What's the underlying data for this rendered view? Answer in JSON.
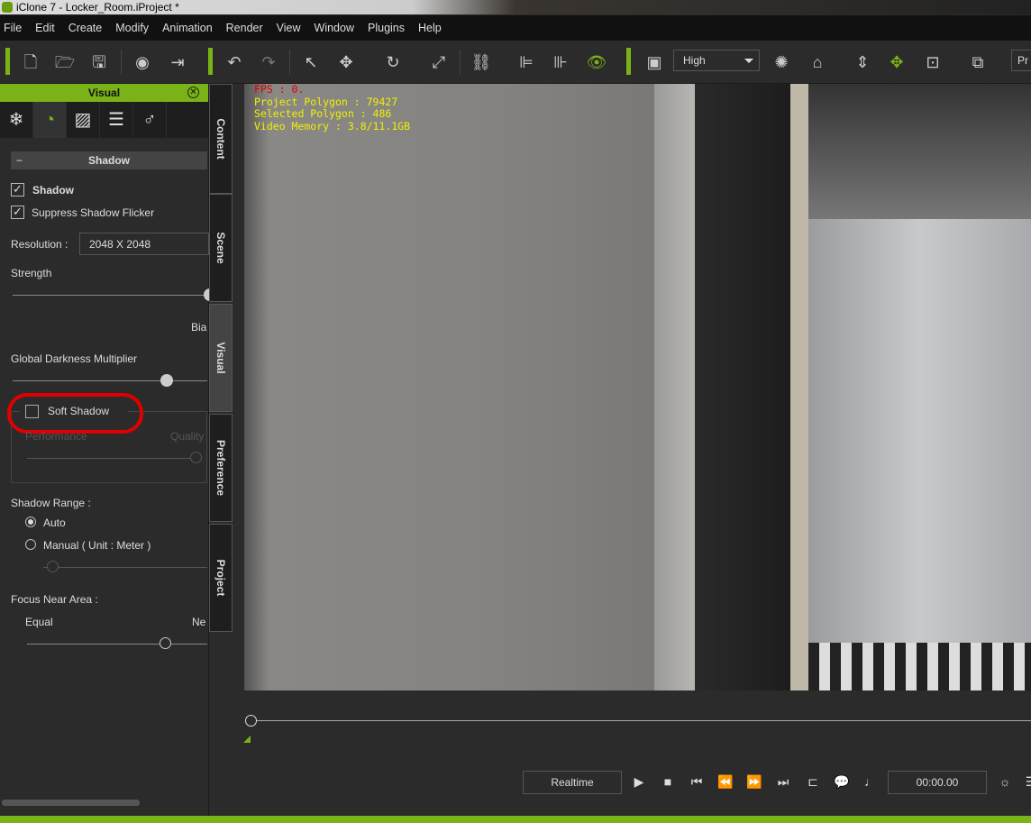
{
  "window": {
    "title": "iClone 7 - Locker_Room.iProject *"
  },
  "menu": [
    "File",
    "Edit",
    "Create",
    "Modify",
    "Animation",
    "Render",
    "View",
    "Window",
    "Plugins",
    "Help"
  ],
  "toolbar": {
    "quality": "High",
    "cut_label": "Pr"
  },
  "panel": {
    "title": "Visual",
    "section": "Shadow",
    "shadow": {
      "label": "Shadow",
      "checked": true
    },
    "suppress": {
      "label": "Suppress Shadow Flicker",
      "checked": true
    },
    "resolution_label": "Resolution :",
    "resolution_value": "2048  X  2048",
    "strength_label": "Strength",
    "bias_label": "Bia",
    "darkness_label": "Global Darkness Multiplier",
    "soft_shadow": {
      "label": "Soft Shadow",
      "checked": false
    },
    "performance_label": "Performance",
    "quality_label": "Quality",
    "range_label": "Shadow Range :",
    "range_auto": "Auto",
    "range_manual": "Manual ( Unit : Meter )",
    "range_selected": "Auto",
    "focus_label": "Focus Near Area :",
    "equal_label": "Equal",
    "near_label": "Ne",
    "highlight_color": "#e00000"
  },
  "side_tabs": [
    "Content",
    "Scene",
    "Visual",
    "Preference",
    "Project"
  ],
  "viewport": {
    "fps": "FPS : 0.",
    "project_polygon": "Project Polygon : 79427",
    "selected_polygon": "Selected Polygon : 486",
    "video_memory": "Video Memory : 3.8/11.1GB"
  },
  "playback": {
    "mode": "Realtime",
    "time": "00:00.00"
  },
  "accent": "#7ab317"
}
